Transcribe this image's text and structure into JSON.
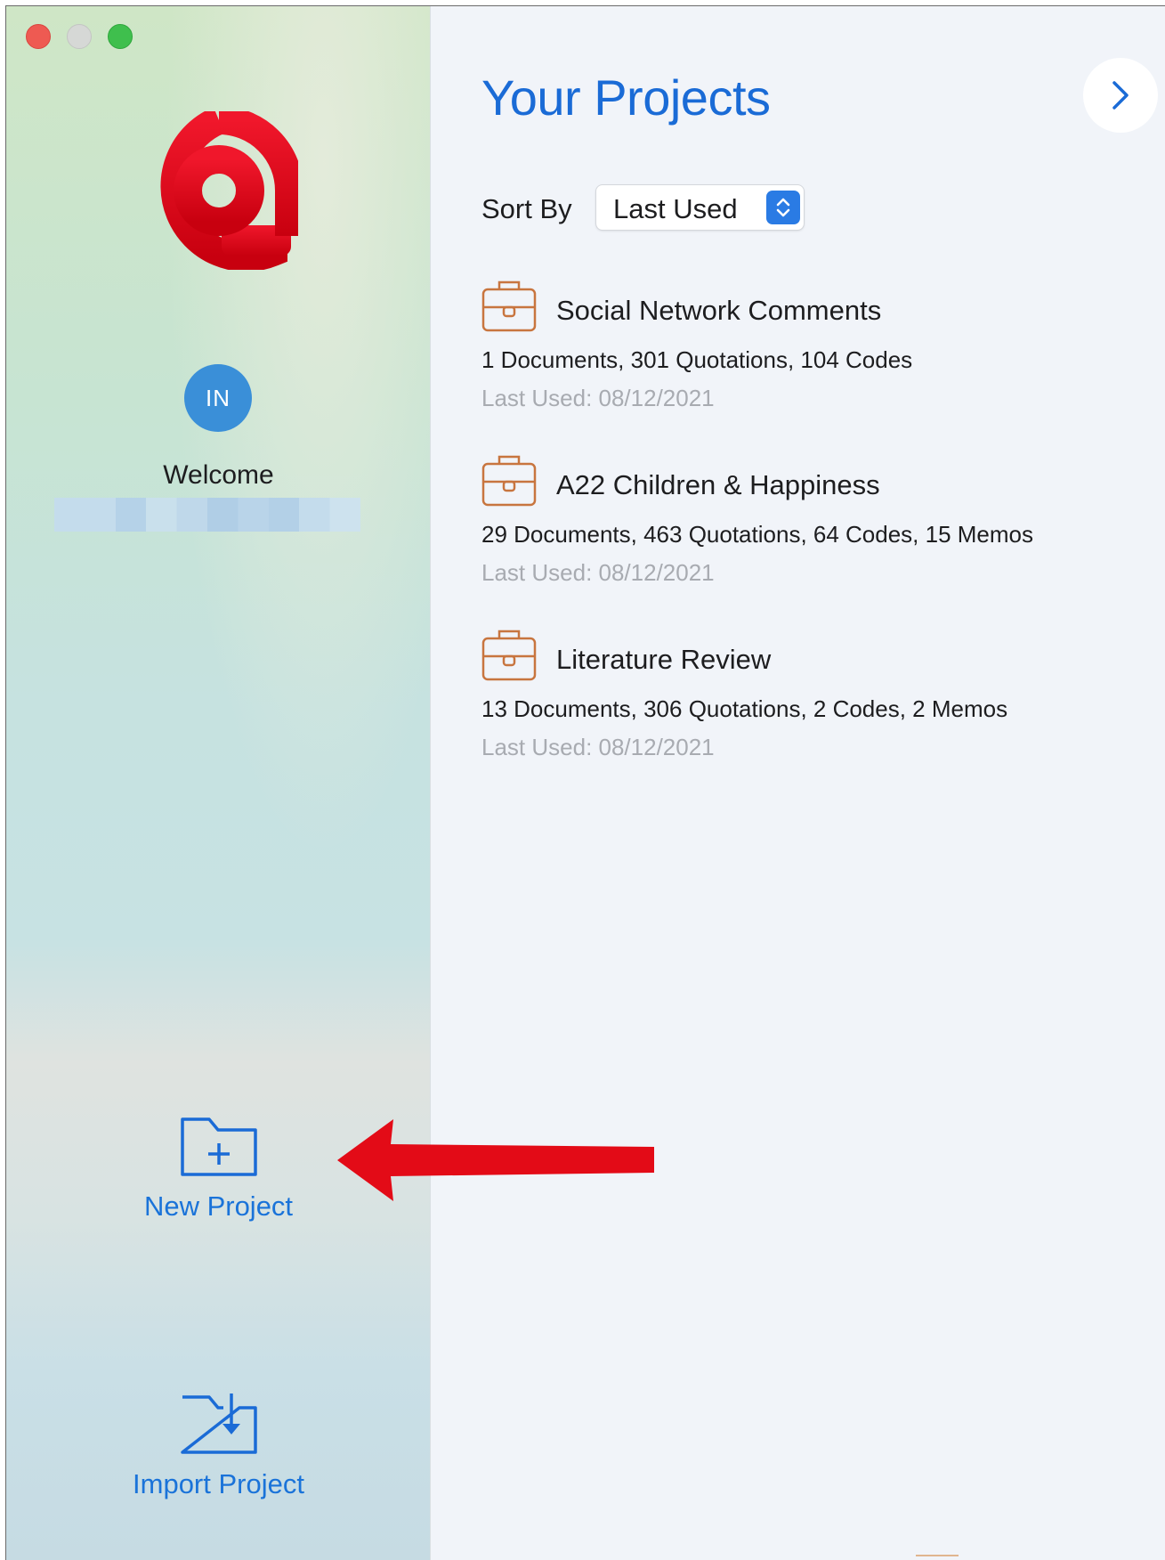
{
  "window": {
    "controls": [
      "close",
      "minimize",
      "zoom"
    ]
  },
  "sidebar": {
    "logo": "atlas-at-logo",
    "avatar_initials": "IN",
    "welcome": "Welcome",
    "new_project_label": "New Project",
    "import_project_label": "Import Project"
  },
  "main": {
    "title": "Your Projects",
    "next_icon": "chevron-right-icon",
    "sort": {
      "label": "Sort By",
      "value": "Last Used"
    },
    "projects": [
      {
        "name": "Social Network Comments",
        "stats": "1 Documents, 301 Quotations, 104 Codes",
        "last_used": "Last Used: 08/12/2021"
      },
      {
        "name": "A22 Children & Happiness",
        "stats": "29 Documents, 463 Quotations, 64 Codes, 15 Memos",
        "last_used": "Last Used: 08/12/2021"
      },
      {
        "name": "Literature Review",
        "stats": "13 Documents, 306 Quotations, 2 Codes, 2 Memos",
        "last_used": "Last Used: 08/12/2021"
      }
    ]
  },
  "colors": {
    "accent": "#1a6bd6",
    "logo_red": "#e00a1b",
    "project_icon": "#c8753f",
    "annotation_arrow": "#e30b17"
  }
}
